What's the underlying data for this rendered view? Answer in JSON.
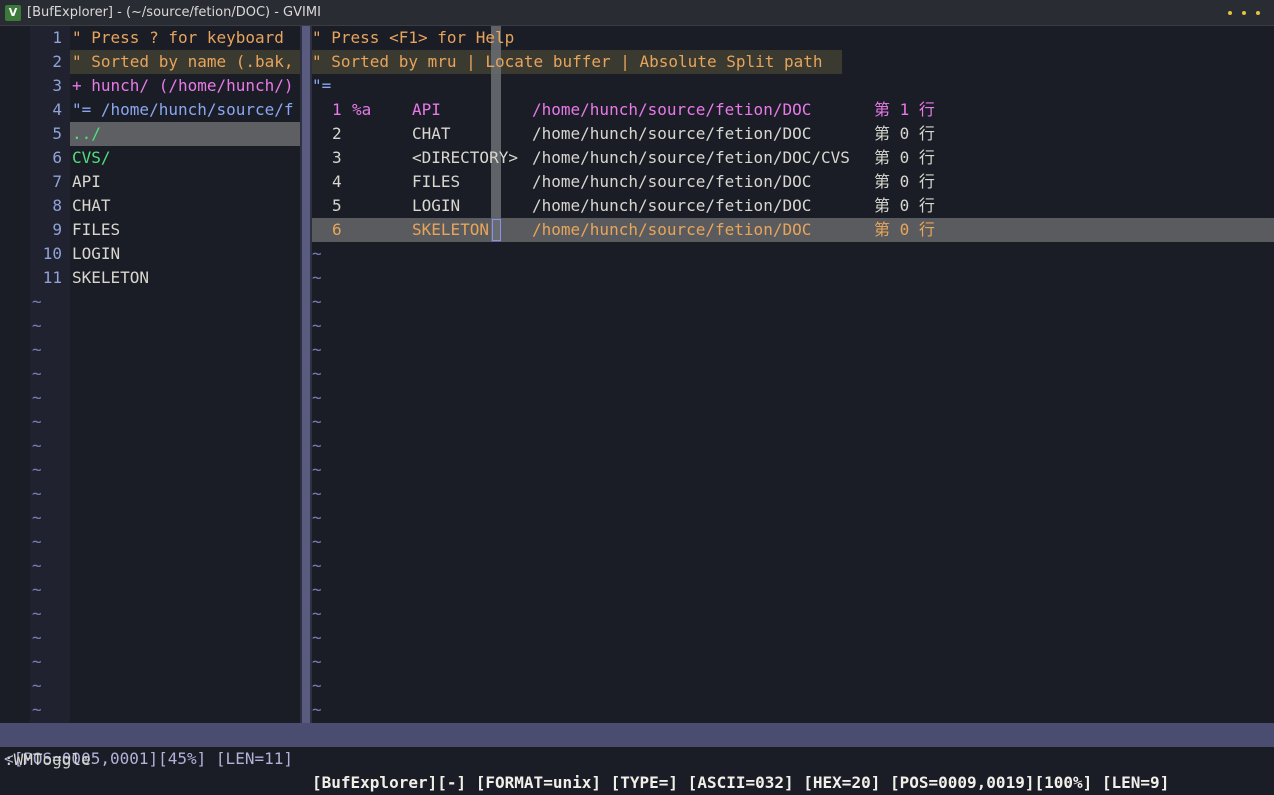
{
  "window": {
    "title": "[BufExplorer] - (~/source/fetion/DOC) - GVIMI",
    "icon_label": "V"
  },
  "left_pane": {
    "lines": [
      {
        "num": "1",
        "text": "\" Press ? for keyboard"
      },
      {
        "num": "2",
        "text": "\" Sorted by name (.bak,"
      },
      {
        "num": "3",
        "text": "+ hunch/ (/home/hunch/)"
      },
      {
        "num": "4",
        "text": "\"= /home/hunch/source/f"
      },
      {
        "num": "5",
        "text": "../"
      },
      {
        "num": "6",
        "text": "CVS/"
      },
      {
        "num": "7",
        "text": "API"
      },
      {
        "num": "8",
        "text": "CHAT"
      },
      {
        "num": "9",
        "text": "FILES"
      },
      {
        "num": "10",
        "text": "LOGIN"
      },
      {
        "num": "11",
        "text": "SKELETON"
      }
    ],
    "tilde": "~"
  },
  "right_pane": {
    "header": [
      "\" Press <F1> for Help",
      "\" Sorted by mru | Locate buffer | Absolute Split path",
      "\"="
    ],
    "buffers": [
      {
        "num": "1",
        "flags": "%a",
        "name": "API",
        "path": "/home/hunch/source/fetion/DOC",
        "line": "第 1 行"
      },
      {
        "num": "2",
        "flags": "",
        "name": "CHAT",
        "path": "/home/hunch/source/fetion/DOC",
        "line": "第 0 行"
      },
      {
        "num": "3",
        "flags": "",
        "name": "<DIRECTORY>",
        "path": "/home/hunch/source/fetion/DOC/CVS",
        "line": "第 0 行"
      },
      {
        "num": "4",
        "flags": "",
        "name": "FILES",
        "path": "/home/hunch/source/fetion/DOC",
        "line": "第 0 行"
      },
      {
        "num": "5",
        "flags": "",
        "name": "LOGIN",
        "path": "/home/hunch/source/fetion/DOC",
        "line": "第 0 行"
      },
      {
        "num": "6",
        "flags": "",
        "name": "SKELETON",
        "path": "/home/hunch/source/fetion/DOC",
        "line": "第 0 行"
      }
    ],
    "tilde": "~"
  },
  "statusbar": {
    "left": "<[POS=0005,0001][45%] [LEN=11]",
    "right": "[BufExplorer][-] [FORMAT=unix] [TYPE=] [ASCII=032] [HEX=20] [POS=0009,0019][100%] [LEN=9]"
  },
  "cmdline": ":WMToggle",
  "colors": {
    "background": "#1b1d26",
    "comment": "#e7a45c",
    "pink": "#e879e8",
    "blue": "#8aa7ef",
    "green": "#4fe07f",
    "statusbar": "#4a4d70"
  }
}
